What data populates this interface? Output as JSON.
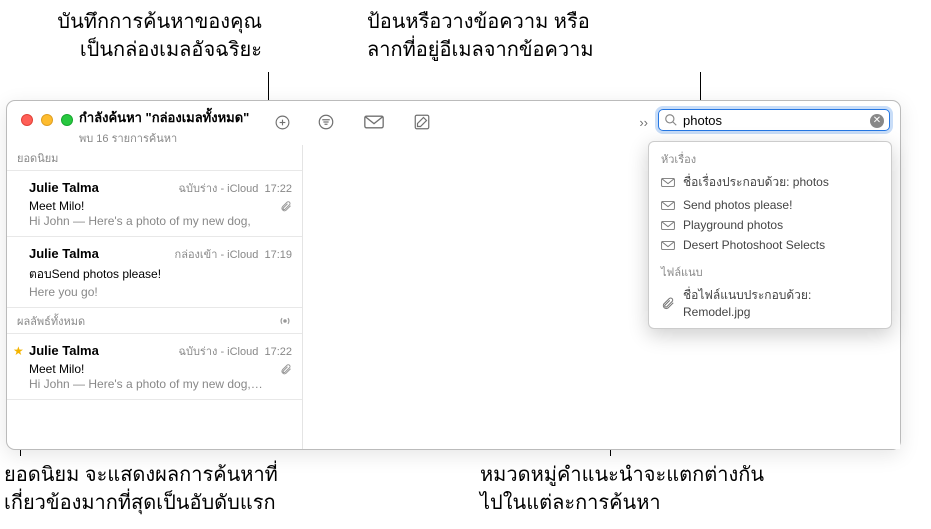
{
  "callouts": {
    "top_left": "บันทึกการค้นหาของคุณ\nเป็นกล่องเมลอัจฉริยะ",
    "top_right": "ป้อนหรือวางข้อความ หรือ\nลากที่อยู่อีเมลจากข้อความ",
    "bottom_left": "ยอดนิยม จะแสดงผลการค้นหาที่\nเกี่ยวข้องมากที่สุดเป็นอับดับแรก",
    "bottom_right": "หมวดหมู่คำแนะนำจะแตกต่างกัน\nไปในแต่ละการค้นหา"
  },
  "window": {
    "title": "กำลังค้นหา \"กล่องเมลทั้งหมด\"",
    "subtitle": "พบ 16 รายการค้นหา"
  },
  "search": {
    "value": "photos"
  },
  "sections": {
    "top": "ยอดนิยม",
    "all": "ผลลัพธ์ทั้งหมด"
  },
  "messages": [
    {
      "sender": "Julie Talma",
      "box": "ฉบับร่าง - iCloud",
      "time": "17:22",
      "subject": "Meet Milo!",
      "preview": "Hi John — Here's a photo of my new dog,",
      "attach": true,
      "star": false
    },
    {
      "sender": "Julie Talma",
      "box": "กล่องเข้า - iCloud",
      "time": "17:19",
      "subject": "ตอบSend photos please!",
      "preview": "Here you go!",
      "attach": false,
      "star": false
    },
    {
      "sender": "Julie Talma",
      "box": "ฉบับร่าง - iCloud",
      "time": "17:22",
      "subject": "Meet Milo!",
      "preview": "Hi John — Here's a photo of my new dog,…",
      "attach": true,
      "star": true
    }
  ],
  "suggestions": {
    "group1_header": "หัวเรื่อง",
    "group1": [
      "ชื่อเรื่องประกอบด้วย: photos",
      "Send photos please!",
      "Playground photos",
      "Desert Photoshoot Selects"
    ],
    "group2_header": "ไฟล์แนบ",
    "group2": [
      "ชื่อไฟล์แนบประกอบด้วย: Remodel.jpg"
    ]
  }
}
